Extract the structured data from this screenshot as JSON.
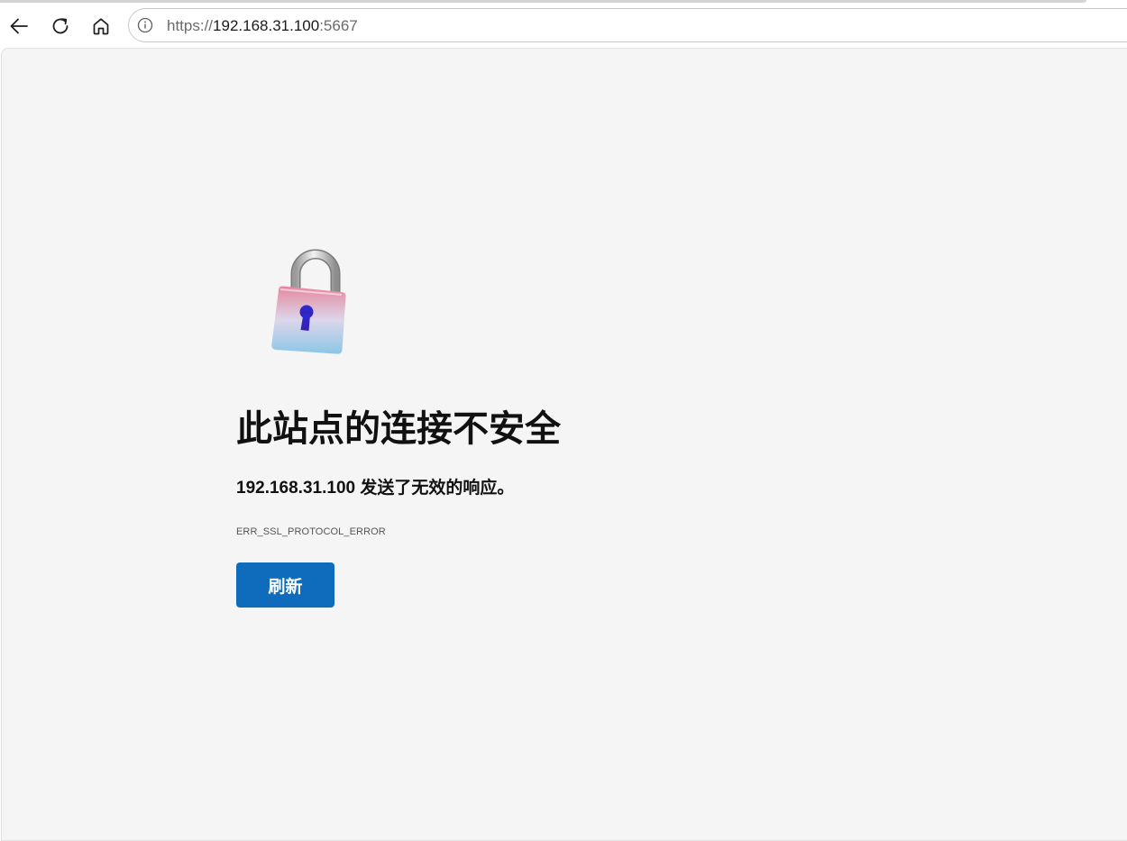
{
  "browser": {
    "back_icon": "arrow-left-icon",
    "reload_icon": "refresh-icon",
    "home_icon": "home-icon",
    "site_info_icon": "info-circle-icon",
    "url": {
      "scheme": "https://",
      "host": "192.168.31.100",
      "port": ":5667"
    }
  },
  "error_page": {
    "illustration_icon": "unlocked-padlock-icon",
    "heading": "此站点的连接不安全",
    "message": "192.168.31.100 发送了无效的响应。",
    "error_code": "ERR_SSL_PROTOCOL_ERROR",
    "reload_label": "刷新"
  },
  "colors": {
    "page_background": "#f5f5f5",
    "button_background": "#0f6cbd",
    "button_text": "#ffffff"
  }
}
